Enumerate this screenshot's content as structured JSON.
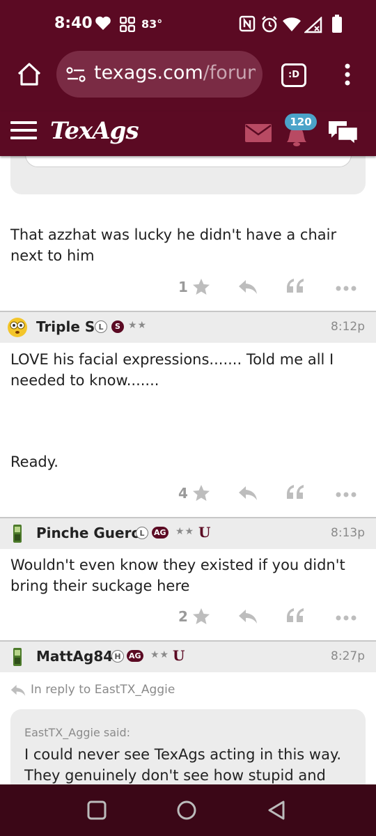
{
  "status_bar": {
    "time": "8:40",
    "temperature": "83°",
    "icons": [
      "heart-icon",
      "grid-icon",
      "nfc-icon",
      "alarm-icon",
      "wifi-icon",
      "signal-icon",
      "battery-icon"
    ]
  },
  "browser": {
    "url_domain": "texags.com",
    "url_path": "/forum",
    "tab_label": ":D"
  },
  "site": {
    "logo": "TexAgs",
    "notification_count": "120",
    "brand_color": "#5b0a23"
  },
  "posts": [
    {
      "text": "That azzhat was lucky he didn't have a chair next to him",
      "star_count": "1"
    },
    {
      "username": "Triple S",
      "badges": [
        "L",
        "S"
      ],
      "stars": "★★",
      "time": "8:12p",
      "text": "LOVE his facial expressions....... Told me all I needed to know.......",
      "text2": "Ready.",
      "star_count": "4"
    },
    {
      "username": "Pinche Guero",
      "badges": [
        "L",
        "AG"
      ],
      "stars": "★★",
      "u_mark": "U",
      "time": "8:13p",
      "text": "Wouldn't even know they existed if you didn't bring their suckage here",
      "star_count": "2"
    },
    {
      "username": "MattAg84",
      "badges": [
        "H",
        "AG"
      ],
      "stars": "★★",
      "u_mark": "U",
      "time": "8:27p",
      "in_reply_to": "In reply to EastTX_Aggie",
      "quote_author": "EastTX_Aggie said:",
      "quote_text": "I could never see TexAgs acting in this way. They genuinely don't see how stupid and"
    }
  ]
}
